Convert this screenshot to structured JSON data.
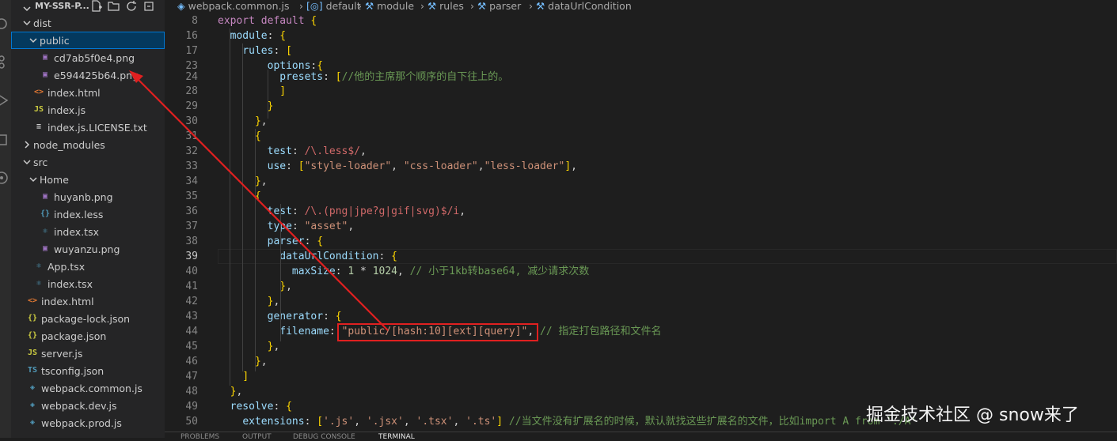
{
  "explorer": {
    "root_title": "MY-SSR-P...",
    "tree": [
      {
        "label": "dist",
        "kind": "folder-open",
        "icon": "chevron-down-icon"
      },
      {
        "label": "public",
        "kind": "folder-open",
        "icon": "chevron-down-icon",
        "selected": true
      },
      {
        "label": "cd7ab5f0e4.png",
        "kind": "file",
        "icon": "image-file-icon"
      },
      {
        "label": "e594425b64.png",
        "kind": "file",
        "icon": "image-file-icon"
      },
      {
        "label": "index.html",
        "kind": "file",
        "icon": "html-file-icon"
      },
      {
        "label": "index.js",
        "kind": "file",
        "icon": "js-file-icon"
      },
      {
        "label": "index.js.LICENSE.txt",
        "kind": "file",
        "icon": "text-file-icon"
      },
      {
        "label": "node_modules",
        "kind": "folder-closed",
        "icon": "chevron-right-icon"
      },
      {
        "label": "src",
        "kind": "folder-open",
        "icon": "chevron-down-icon"
      },
      {
        "label": "Home",
        "kind": "folder-open",
        "icon": "chevron-down-icon"
      },
      {
        "label": "huyanb.png",
        "kind": "file",
        "icon": "image-file-icon"
      },
      {
        "label": "index.less",
        "kind": "file",
        "icon": "braces-file-icon"
      },
      {
        "label": "index.tsx",
        "kind": "file",
        "icon": "react-file-icon"
      },
      {
        "label": "wuyanzu.png",
        "kind": "file",
        "icon": "image-file-icon"
      },
      {
        "label": "App.tsx",
        "kind": "file",
        "icon": "react-file-icon"
      },
      {
        "label": "index.tsx",
        "kind": "file",
        "icon": "react-file-icon"
      },
      {
        "label": "index.html",
        "kind": "file",
        "icon": "html-file-icon"
      },
      {
        "label": "package-lock.json",
        "kind": "file",
        "icon": "json-file-icon"
      },
      {
        "label": "package.json",
        "kind": "file",
        "icon": "json-file-icon"
      },
      {
        "label": "server.js",
        "kind": "file",
        "icon": "js-file-icon"
      },
      {
        "label": "tsconfig.json",
        "kind": "file",
        "icon": "ts-file-icon"
      },
      {
        "label": "webpack.common.js",
        "kind": "file",
        "icon": "webpack-file-icon"
      },
      {
        "label": "webpack.dev.js",
        "kind": "file",
        "icon": "webpack-file-icon"
      },
      {
        "label": "webpack.prod.js",
        "kind": "file",
        "icon": "webpack-file-icon"
      }
    ]
  },
  "breadcrumb": [
    {
      "label": "webpack.common.js",
      "icon": "webpack-file-icon"
    },
    {
      "label": "default",
      "icon": "module-symbol-icon"
    },
    {
      "label": "module",
      "icon": "wrench-icon"
    },
    {
      "label": "rules",
      "icon": "wrench-icon"
    },
    {
      "label": "parser",
      "icon": "wrench-icon"
    },
    {
      "label": "dataUrlCondition",
      "icon": "wrench-icon"
    }
  ],
  "editor": {
    "active_line": "39",
    "lines": [
      {
        "n": "8",
        "code": "export default {"
      },
      {
        "n": "16",
        "code": "  module: {"
      },
      {
        "n": "17",
        "code": "    rules: ["
      },
      {
        "n": "23",
        "code": "        options:{"
      },
      {
        "n": "24",
        "code": "          presets: [//他的主席那个顺序的自下往上的。"
      },
      {
        "n": "28",
        "code": "          ]"
      },
      {
        "n": "29",
        "code": "        }"
      },
      {
        "n": "30",
        "code": "      },"
      },
      {
        "n": "31",
        "code": "      {"
      },
      {
        "n": "32",
        "code": "        test: /\\.less$/,"
      },
      {
        "n": "33",
        "code": "        use: [\"style-loader\", \"css-loader\",\"less-loader\"],"
      },
      {
        "n": "34",
        "code": "      },"
      },
      {
        "n": "35",
        "code": "      {"
      },
      {
        "n": "36",
        "code": "        test: /\\.(png|jpe?g|gif|svg)$/i,"
      },
      {
        "n": "37",
        "code": "        type: \"asset\","
      },
      {
        "n": "38",
        "code": "        parser: {"
      },
      {
        "n": "39",
        "code": "          dataUrlCondition: {"
      },
      {
        "n": "40",
        "code": "            maxSize: 1 * 1024, // 小于1kb转base64, 减少请求次数"
      },
      {
        "n": "41",
        "code": "          },"
      },
      {
        "n": "42",
        "code": "        },"
      },
      {
        "n": "43",
        "code": "        generator: {"
      },
      {
        "n": "44",
        "code": "          filename: \"public/[hash:10][ext][query]\", // 指定打包路径和文件名"
      },
      {
        "n": "45",
        "code": "        },"
      },
      {
        "n": "46",
        "code": "      },"
      },
      {
        "n": "47",
        "code": "    ]"
      },
      {
        "n": "48",
        "code": "  },"
      },
      {
        "n": "49",
        "code": "  resolve: {"
      },
      {
        "n": "50",
        "code": "    extensions: ['.js', '.jsx', '.tsx', '.ts'] //当文件没有扩展名的时候，默认就找这些扩展名的文件，比如import A from './A'"
      }
    ]
  },
  "panel_tabs": [
    "PROBLEMS",
    "OUTPUT",
    "DEBUG CONSOLE",
    "TERMINAL"
  ],
  "watermark": "掘金技术社区 @ snow来了",
  "annotation": {
    "arrow_color": "#e02020"
  }
}
